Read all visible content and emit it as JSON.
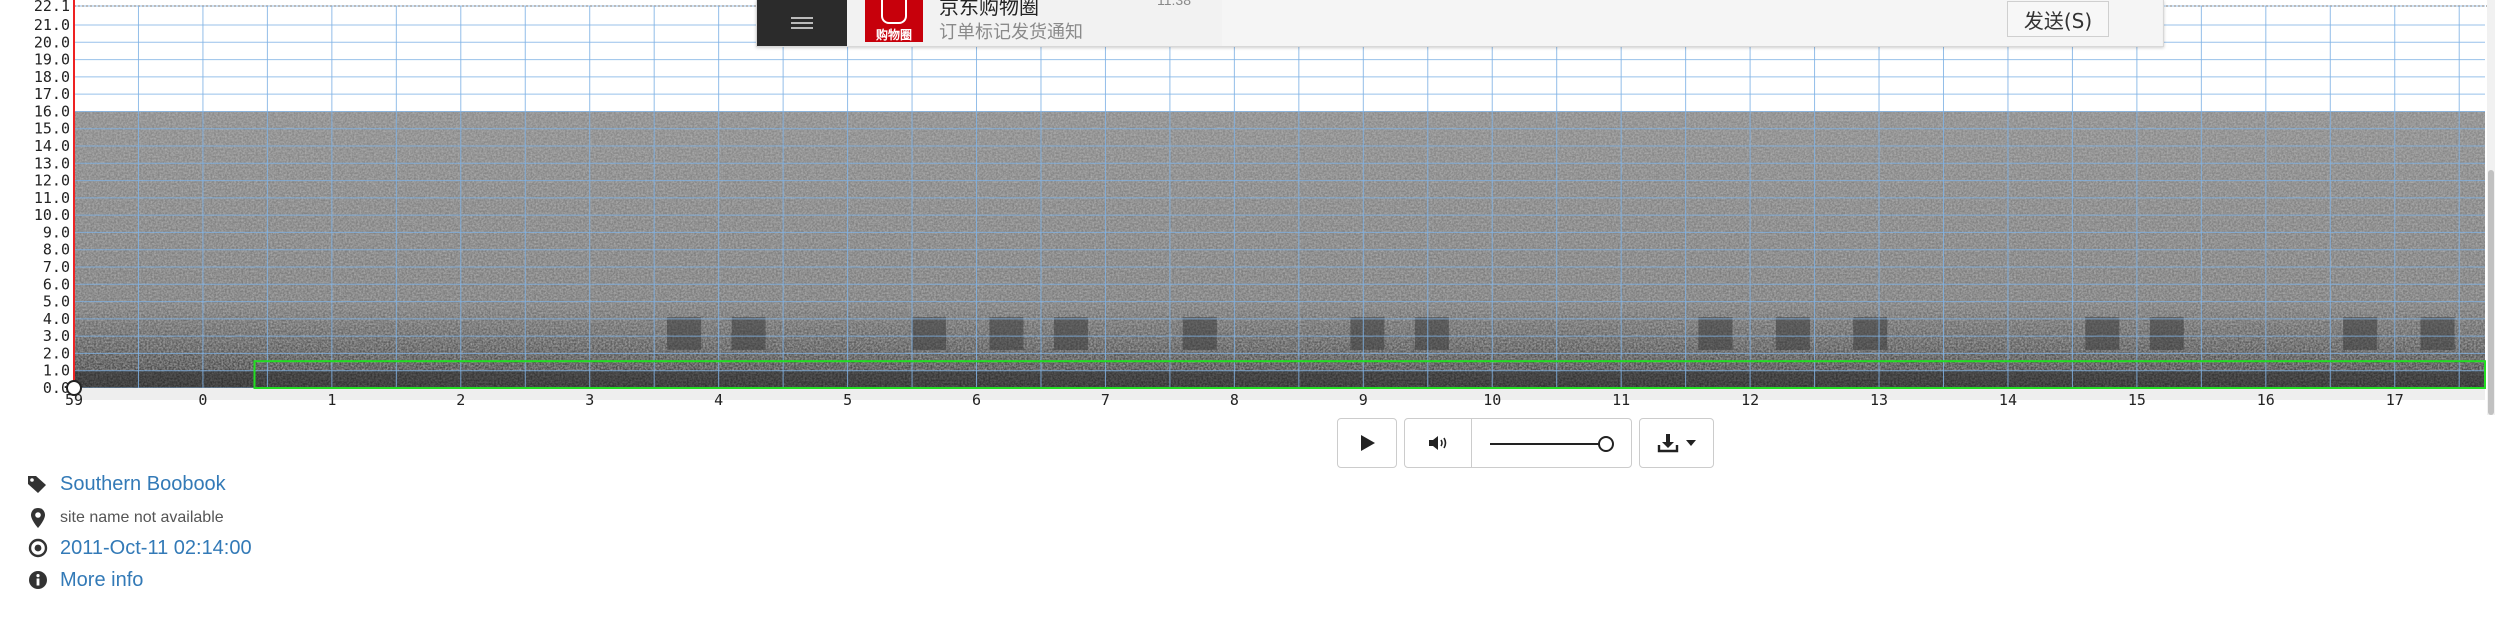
{
  "spectrogram": {
    "y_ticks": [
      "0.0",
      "1.0",
      "2.0",
      "3.0",
      "4.0",
      "5.0",
      "6.0",
      "7.0",
      "8.0",
      "9.0",
      "10.0",
      "11.0",
      "12.0",
      "13.0",
      "14.0",
      "15.0",
      "16.0",
      "17.0",
      "18.0",
      "19.0",
      "20.0",
      "21.0",
      "22.1"
    ],
    "x_ticks": [
      "59",
      "0",
      "1",
      "2",
      "3",
      "4",
      "5",
      "6",
      "7",
      "8",
      "9",
      "10",
      "11",
      "12",
      "13",
      "14",
      "15",
      "16",
      "17"
    ],
    "grid_color": "#7fb2e5",
    "selection_color": "#22dd22",
    "cursor_color": "#ee2222"
  },
  "notification": {
    "app_title": "京东购物圈",
    "time": "11:38",
    "message": "订单标记发货通知",
    "logo_text": "购物圈",
    "send_label": "发送(S)"
  },
  "player": {
    "play_icon": "play-icon",
    "volume_icon": "volume-icon",
    "volume_level": 1.0,
    "download_icon": "download-icon"
  },
  "meta": {
    "species": "Southern Boobook",
    "site": "site name not available",
    "datetime": "2011-Oct-11 02:14:00",
    "more_info": "More info"
  }
}
